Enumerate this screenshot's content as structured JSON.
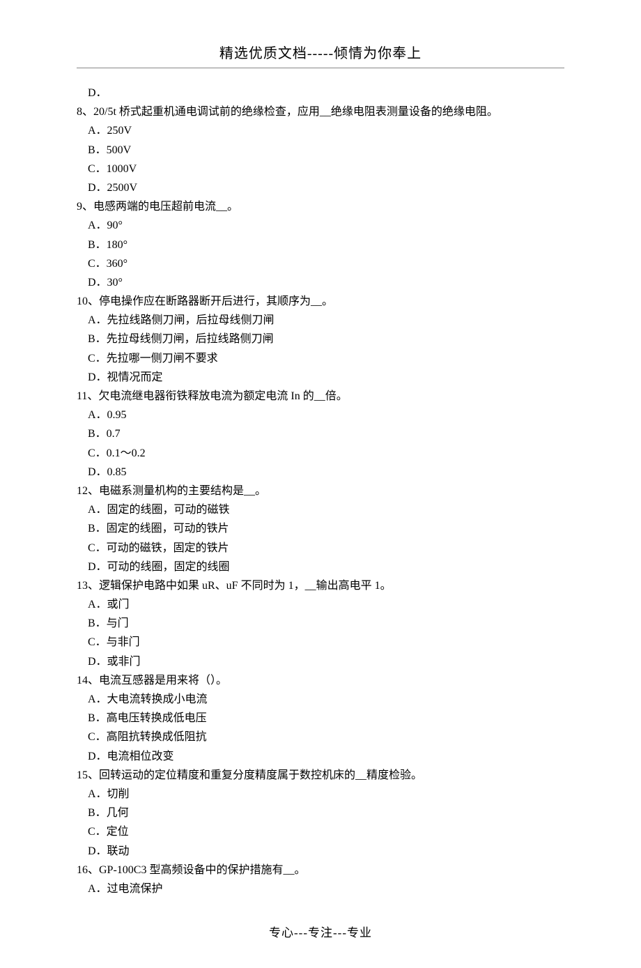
{
  "header": "精选优质文档-----倾情为你奉上",
  "footer": "专心---专注---专业",
  "lines": [
    {
      "cls": "option",
      "text": "D．"
    },
    {
      "cls": "question",
      "text": "8、20/5t 桥式起重机通电调试前的绝缘检查，应用__绝缘电阻表测量设备的绝缘电阻。"
    },
    {
      "cls": "option",
      "text": "A．250V"
    },
    {
      "cls": "option",
      "text": "B．500V"
    },
    {
      "cls": "option",
      "text": "C．1000V"
    },
    {
      "cls": "option",
      "text": "D．2500V"
    },
    {
      "cls": "question",
      "text": "9、电感两端的电压超前电流__。"
    },
    {
      "cls": "option",
      "text": "A．90°"
    },
    {
      "cls": "option",
      "text": "B．180°"
    },
    {
      "cls": "option",
      "text": "C．360°"
    },
    {
      "cls": "option",
      "text": "D．30°"
    },
    {
      "cls": "question",
      "text": "10、停电操作应在断路器断开后进行，其顺序为__。"
    },
    {
      "cls": "option",
      "text": "A．先拉线路侧刀闸，后拉母线侧刀闸"
    },
    {
      "cls": "option",
      "text": "B．先拉母线侧刀闸，后拉线路侧刀闸"
    },
    {
      "cls": "option",
      "text": "C．先拉哪一侧刀闸不要求"
    },
    {
      "cls": "option",
      "text": "D．视情况而定"
    },
    {
      "cls": "question",
      "text": "11、欠电流继电器衔铁释放电流为额定电流 In 的__倍。"
    },
    {
      "cls": "option",
      "text": "A．0.95"
    },
    {
      "cls": "option",
      "text": "B．0.7"
    },
    {
      "cls": "option",
      "text": "C．0.1～0.2"
    },
    {
      "cls": "option",
      "text": "D．0.85"
    },
    {
      "cls": "question",
      "text": "12、电磁系测量机构的主要结构是__。"
    },
    {
      "cls": "option",
      "text": "A．固定的线圈，可动的磁铁"
    },
    {
      "cls": "option",
      "text": "B．固定的线圈，可动的铁片"
    },
    {
      "cls": "option",
      "text": "C．可动的磁铁，固定的铁片"
    },
    {
      "cls": "option",
      "text": "D．可动的线圈，固定的线圈"
    },
    {
      "cls": "question",
      "text": "13、逻辑保护电路中如果 uR、uF 不同时为 1，__输出高电平 1。"
    },
    {
      "cls": "option",
      "text": "A．或门"
    },
    {
      "cls": "option",
      "text": "B．与门"
    },
    {
      "cls": "option",
      "text": "C．与非门"
    },
    {
      "cls": "option",
      "text": "D．或非门"
    },
    {
      "cls": "question",
      "text": "14、电流互感器是用来将（）。"
    },
    {
      "cls": "option",
      "text": "A．大电流转换成小电流"
    },
    {
      "cls": "option",
      "text": "B．高电压转换成低电压"
    },
    {
      "cls": "option",
      "text": "C．高阻抗转换成低阻抗"
    },
    {
      "cls": "option",
      "text": "D．电流相位改变"
    },
    {
      "cls": "question",
      "text": "15、回转运动的定位精度和重复分度精度属于数控机床的__精度检验。"
    },
    {
      "cls": "option",
      "text": "A．切削"
    },
    {
      "cls": "option",
      "text": "B．几何"
    },
    {
      "cls": "option",
      "text": "C．定位"
    },
    {
      "cls": "option",
      "text": "D．联动"
    },
    {
      "cls": "question",
      "text": "16、GP-100C3 型高频设备中的保护措施有__。"
    },
    {
      "cls": "option",
      "text": "A．过电流保护"
    }
  ]
}
